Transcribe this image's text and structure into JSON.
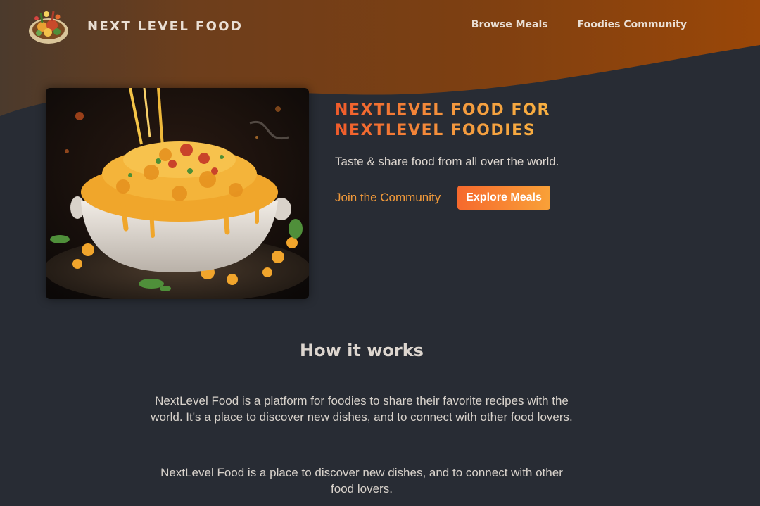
{
  "header": {
    "logo_icon": "food-plate-icon",
    "brand": "NEXT LEVEL FOOD",
    "nav": [
      {
        "label": "Browse Meals"
      },
      {
        "label": "Foodies Community"
      }
    ]
  },
  "hero": {
    "image": "mac-and-cheese-bowl-image",
    "title_line1": "NEXTLEVEL FOOD FOR",
    "title_line2": "NEXTLEVEL FOODIES",
    "tagline": "Taste & share food from all over the world.",
    "cta_link": "Join the Community",
    "cta_button": "Explore Meals"
  },
  "how_it_works": {
    "title": "How it works",
    "paragraph1": "NextLevel Food is a platform for foodies to share their favorite recipes with the world. It's a place to discover new dishes, and to connect with other food lovers.",
    "paragraph2": "NextLevel Food is a place to discover new dishes, and to connect with other food lovers."
  },
  "colors": {
    "background": "#282c34",
    "accent_start": "#f15b2b",
    "accent_end": "#f8b241",
    "header_brown": "#8a4512"
  }
}
